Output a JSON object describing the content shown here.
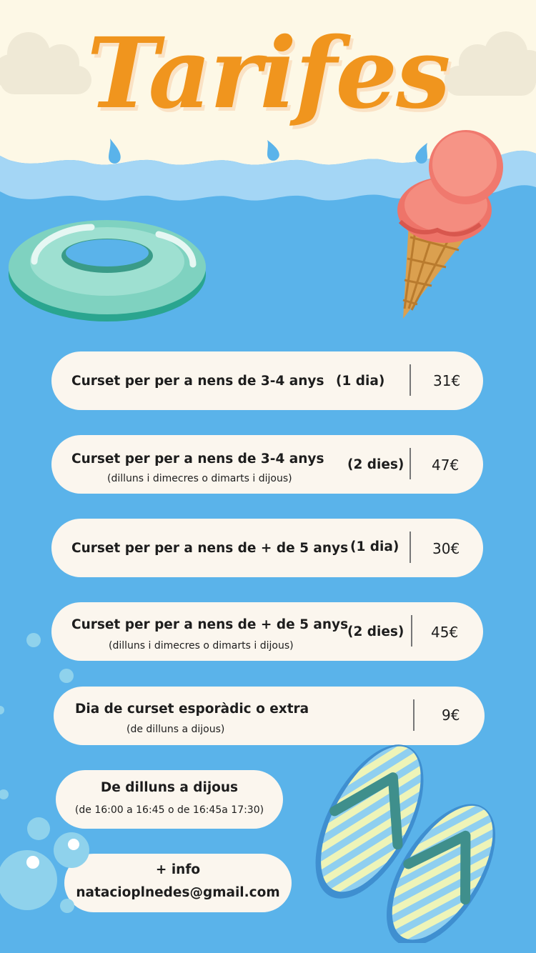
{
  "header": {
    "title": "Tarifes"
  },
  "rates": [
    {
      "title": "Curset per per a nens de 3-4 anys",
      "tag": "(1 dia)",
      "subtitle": "",
      "price": "31€"
    },
    {
      "title": "Curset per per a nens de 3-4 anys",
      "tag": "(2 dies)",
      "subtitle": "(dilluns i dimecres o dimarts i dijous)",
      "price": "47€"
    },
    {
      "title": "Curset per per a nens de + de 5 anys",
      "tag": "(1 dia)",
      "subtitle": "",
      "price": "30€"
    },
    {
      "title": "Curset per per a nens de + de 5 anys",
      "tag": "(2 dies)",
      "subtitle": "(dilluns i dimecres o dimarts i dijous)",
      "price": "45€"
    },
    {
      "title": "Dia de curset esporàdic o extra",
      "tag": "",
      "subtitle": "(de dilluns a dijous)",
      "price": "9€"
    }
  ],
  "schedule": {
    "title": "De dilluns a dijous",
    "hours": "(de 16:00 a 16:45 o de 16:45a 17:30)"
  },
  "contact": {
    "label": "+ info",
    "email": "natacioplnedes@gmail.com"
  },
  "colors": {
    "background": "#5ab3ea",
    "title": "#f0951e",
    "card": "#fbf6ee",
    "cream": "#fdf8e6"
  },
  "icons": [
    "swim-ring-icon",
    "ice-cream-icon",
    "flip-flops-icon",
    "bubbles-icon",
    "cloud-icon",
    "water-drop-icon"
  ]
}
